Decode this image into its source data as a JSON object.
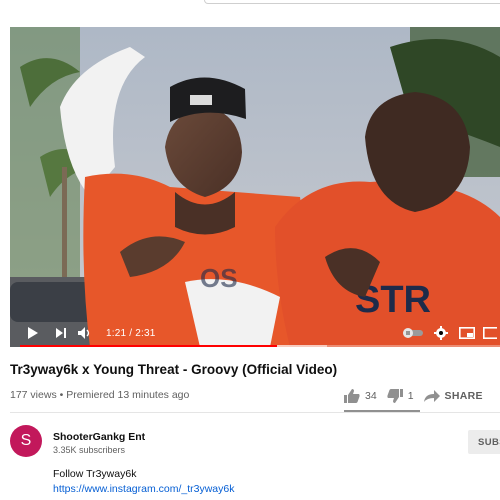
{
  "player": {
    "current_time": "1:21",
    "duration": "2:31",
    "progress_fraction": 0.536,
    "buffered_fraction": 0.64,
    "time_display": "1:21 / 2:31"
  },
  "video": {
    "title": "Tr3yway6k x Young Threat - Groovy (Official Video)",
    "views": "177 views",
    "premiered": "Premiered 13 minutes ago",
    "meta_line": "177 views • Premiered 13 minutes ago"
  },
  "actions": {
    "likes": "34",
    "dislikes": "1",
    "share_label": "SHARE"
  },
  "channel": {
    "avatar_letter": "S",
    "name": "ShooterGankg Ent",
    "subscribers": "3.35K subscribers",
    "subscribe_label": "SUBS"
  },
  "description": {
    "line1": "Follow Tr3yway6k",
    "link": "https://www.instagram.com/_tr3yway6k"
  },
  "colors": {
    "progress": "#ff0000",
    "link": "#065fd4",
    "avatar": "#c2185b"
  },
  "icons": [
    "play-icon",
    "next-icon",
    "volume-icon",
    "autoplay-toggle-icon",
    "settings-icon",
    "miniplayer-icon",
    "theater-icon",
    "like-icon",
    "dislike-icon",
    "share-icon"
  ]
}
